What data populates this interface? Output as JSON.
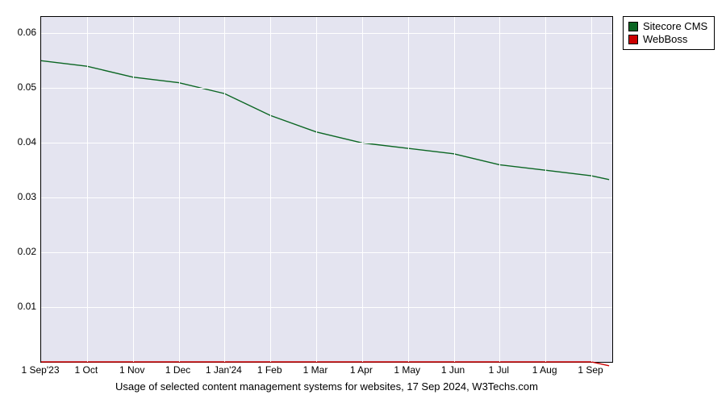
{
  "chart_data": {
    "type": "line",
    "categories": [
      "1 Sep'23",
      "1 Oct",
      "1 Nov",
      "1 Dec",
      "1 Jan'24",
      "1 Feb",
      "1 Mar",
      "1 Apr",
      "1 May",
      "1 Jun",
      "1 Jul",
      "1 Aug",
      "1 Sep"
    ],
    "series": [
      {
        "name": "Sitecore CMS",
        "color": "#0b6623",
        "values": [
          0.055,
          0.054,
          0.052,
          0.051,
          0.049,
          0.045,
          0.042,
          0.04,
          0.039,
          0.038,
          0.036,
          0.035,
          0.034
        ]
      },
      {
        "name": "WebBoss",
        "color": "#cc0000",
        "values": [
          0.0,
          0.0,
          0.0,
          0.0,
          0.0,
          0.0,
          0.0,
          0.0,
          0.0,
          0.0,
          0.0,
          0.0,
          0.0
        ]
      }
    ],
    "xlabel": "",
    "ylabel": "",
    "ylim": [
      0,
      0.063
    ],
    "yticks": [
      0.01,
      0.02,
      0.03,
      0.04,
      0.05,
      0.06
    ],
    "caption": "Usage of selected content management systems for websites, 17 Sep 2024, W3Techs.com"
  },
  "legend": {
    "items": [
      {
        "label": "Sitecore CMS",
        "color": "#0b6623"
      },
      {
        "label": "WebBoss",
        "color": "#cc0000"
      }
    ]
  }
}
